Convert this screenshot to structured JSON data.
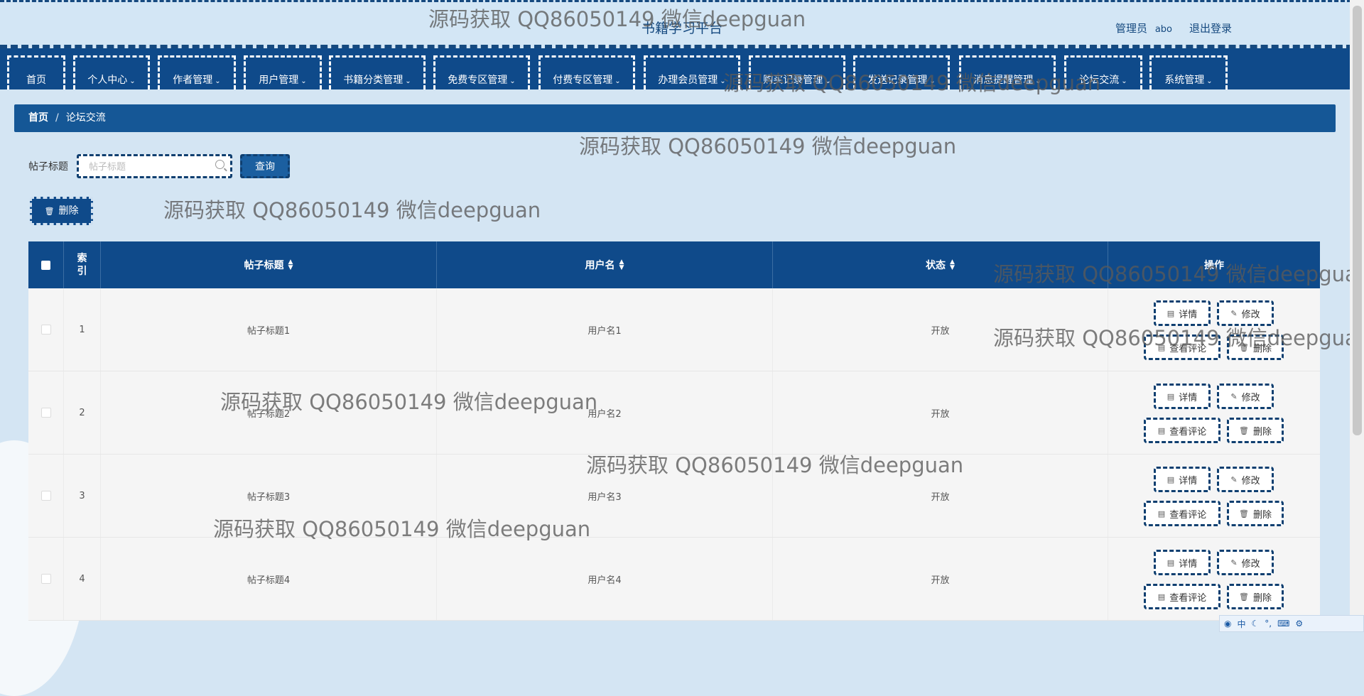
{
  "header": {
    "site_title": "书籍学习平台",
    "admin_label": "管理员",
    "admin_user": "abo",
    "logout_label": "退出登录"
  },
  "nav": {
    "items": [
      {
        "label": "首页",
        "has_chevron": false
      },
      {
        "label": "个人中心",
        "has_chevron": true
      },
      {
        "label": "作者管理",
        "has_chevron": true
      },
      {
        "label": "用户管理",
        "has_chevron": true
      },
      {
        "label": "书籍分类管理",
        "has_chevron": true
      },
      {
        "label": "免费专区管理",
        "has_chevron": true
      },
      {
        "label": "付费专区管理",
        "has_chevron": true
      },
      {
        "label": "办理会员管理",
        "has_chevron": true
      },
      {
        "label": "购买记录管理",
        "has_chevron": true
      },
      {
        "label": "发送记录管理",
        "has_chevron": true
      },
      {
        "label": "消息提醒管理",
        "has_chevron": true
      },
      {
        "label": "论坛交流",
        "has_chevron": true
      },
      {
        "label": "系统管理",
        "has_chevron": true
      }
    ]
  },
  "breadcrumb": {
    "home": "首页",
    "separator": "/",
    "current": "论坛交流"
  },
  "search": {
    "label": "帖子标题",
    "placeholder": "帖子标题",
    "value": "",
    "query_label": "查询"
  },
  "toolbar": {
    "delete_label": "删除"
  },
  "table": {
    "columns": {
      "index": "索引",
      "title": "帖子标题",
      "username": "用户名",
      "status": "状态",
      "actions": "操作"
    },
    "rows": [
      {
        "index": "1",
        "title": "帖子标题1",
        "username": "用户名1",
        "status": "开放"
      },
      {
        "index": "2",
        "title": "帖子标题2",
        "username": "用户名2",
        "status": "开放"
      },
      {
        "index": "3",
        "title": "帖子标题3",
        "username": "用户名3",
        "status": "开放"
      },
      {
        "index": "4",
        "title": "帖子标题4",
        "username": "用户名4",
        "status": "开放"
      }
    ],
    "actions": {
      "detail": "详情",
      "edit": "修改",
      "comments": "查看评论",
      "delete": "删除"
    }
  },
  "watermark_text": "源码获取 QQ86050149 微信deepguan",
  "ime": {
    "lang": "中"
  },
  "colors": {
    "primary": "#0f4a8a",
    "background": "#d4e5f3",
    "breadcrumb": "#155796"
  }
}
